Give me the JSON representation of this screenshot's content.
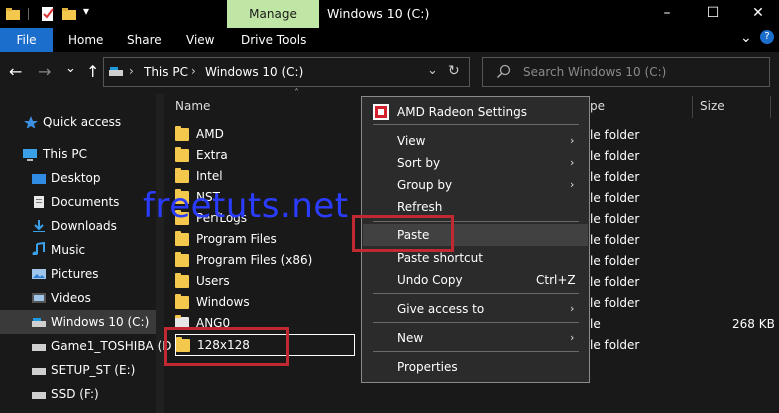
{
  "window": {
    "title": "Windows 10 (C:)",
    "manage_tab": "Manage",
    "buttons": {
      "minimize": "–",
      "maximize": "☐",
      "close": "✕"
    }
  },
  "ribbon": {
    "tabs": [
      "File",
      "Home",
      "Share",
      "View",
      "Drive Tools"
    ],
    "chevron": "⌄",
    "help": "?"
  },
  "address": {
    "back": "←",
    "forward": "→",
    "recent": "⌄",
    "up": "↑",
    "crumbs": [
      "This PC",
      "Windows 10 (C:)"
    ],
    "sep": "›",
    "dropdown": "⌄",
    "refresh": "↻",
    "search_placeholder": "Search Windows 10 (C:)"
  },
  "sidebar": {
    "items": [
      {
        "label": "Quick access",
        "icon": "star-icon"
      },
      {
        "label": "This PC",
        "icon": "computer-icon"
      },
      {
        "label": "Desktop",
        "icon": "desktop-icon"
      },
      {
        "label": "Documents",
        "icon": "documents-icon"
      },
      {
        "label": "Downloads",
        "icon": "downloads-icon"
      },
      {
        "label": "Music",
        "icon": "music-icon"
      },
      {
        "label": "Pictures",
        "icon": "pictures-icon"
      },
      {
        "label": "Videos",
        "icon": "videos-icon"
      },
      {
        "label": "Windows 10 (C:)",
        "icon": "drive-icon"
      },
      {
        "label": "Game1_TOSHIBA (D",
        "icon": "drive-icon"
      },
      {
        "label": "SETUP_ST (E:)",
        "icon": "drive-icon"
      },
      {
        "label": "SSD (F:)",
        "icon": "drive-icon"
      }
    ]
  },
  "columns": {
    "name": "Name",
    "type": "pe",
    "size": "Size"
  },
  "files": [
    {
      "name": "AMD",
      "type": "le folder",
      "size": ""
    },
    {
      "name": "Extra",
      "type": "le folder",
      "size": ""
    },
    {
      "name": "Intel",
      "type": "le folder",
      "size": ""
    },
    {
      "name": "NST",
      "type": "le folder",
      "size": ""
    },
    {
      "name": "PerfLogs",
      "type": "le folder",
      "size": ""
    },
    {
      "name": "Program Files",
      "type": "le folder",
      "size": ""
    },
    {
      "name": "Program Files (x86)",
      "type": "le folder",
      "size": ""
    },
    {
      "name": "Users",
      "type": "le folder",
      "size": ""
    },
    {
      "name": "Windows",
      "type": "le folder",
      "size": ""
    },
    {
      "name": "ANG0",
      "type": "le",
      "size": "268 KB"
    },
    {
      "name": "128x128",
      "type": "le folder",
      "size": ""
    }
  ],
  "context_menu": {
    "items": [
      {
        "label": "AMD Radeon Settings",
        "shortcut": "",
        "submenu": false
      },
      {
        "label": "View",
        "shortcut": "",
        "submenu": true
      },
      {
        "label": "Sort by",
        "shortcut": "",
        "submenu": true
      },
      {
        "label": "Group by",
        "shortcut": "",
        "submenu": true
      },
      {
        "label": "Refresh",
        "shortcut": "",
        "submenu": false
      },
      {
        "label": "Paste",
        "shortcut": "",
        "submenu": false
      },
      {
        "label": "Paste shortcut",
        "shortcut": "",
        "submenu": false
      },
      {
        "label": "Undo Copy",
        "shortcut": "Ctrl+Z",
        "submenu": false
      },
      {
        "label": "Give access to",
        "shortcut": "",
        "submenu": true
      },
      {
        "label": "New",
        "shortcut": "",
        "submenu": true
      },
      {
        "label": "Properties",
        "shortcut": "",
        "submenu": false
      }
    ],
    "submenu_arrow": "›"
  },
  "watermark": "freetuts.net",
  "colors": {
    "accent": "#1c6ecc",
    "manage": "#bfe6a5",
    "highlight": "#c0292f",
    "folder": "#f3c84c"
  }
}
